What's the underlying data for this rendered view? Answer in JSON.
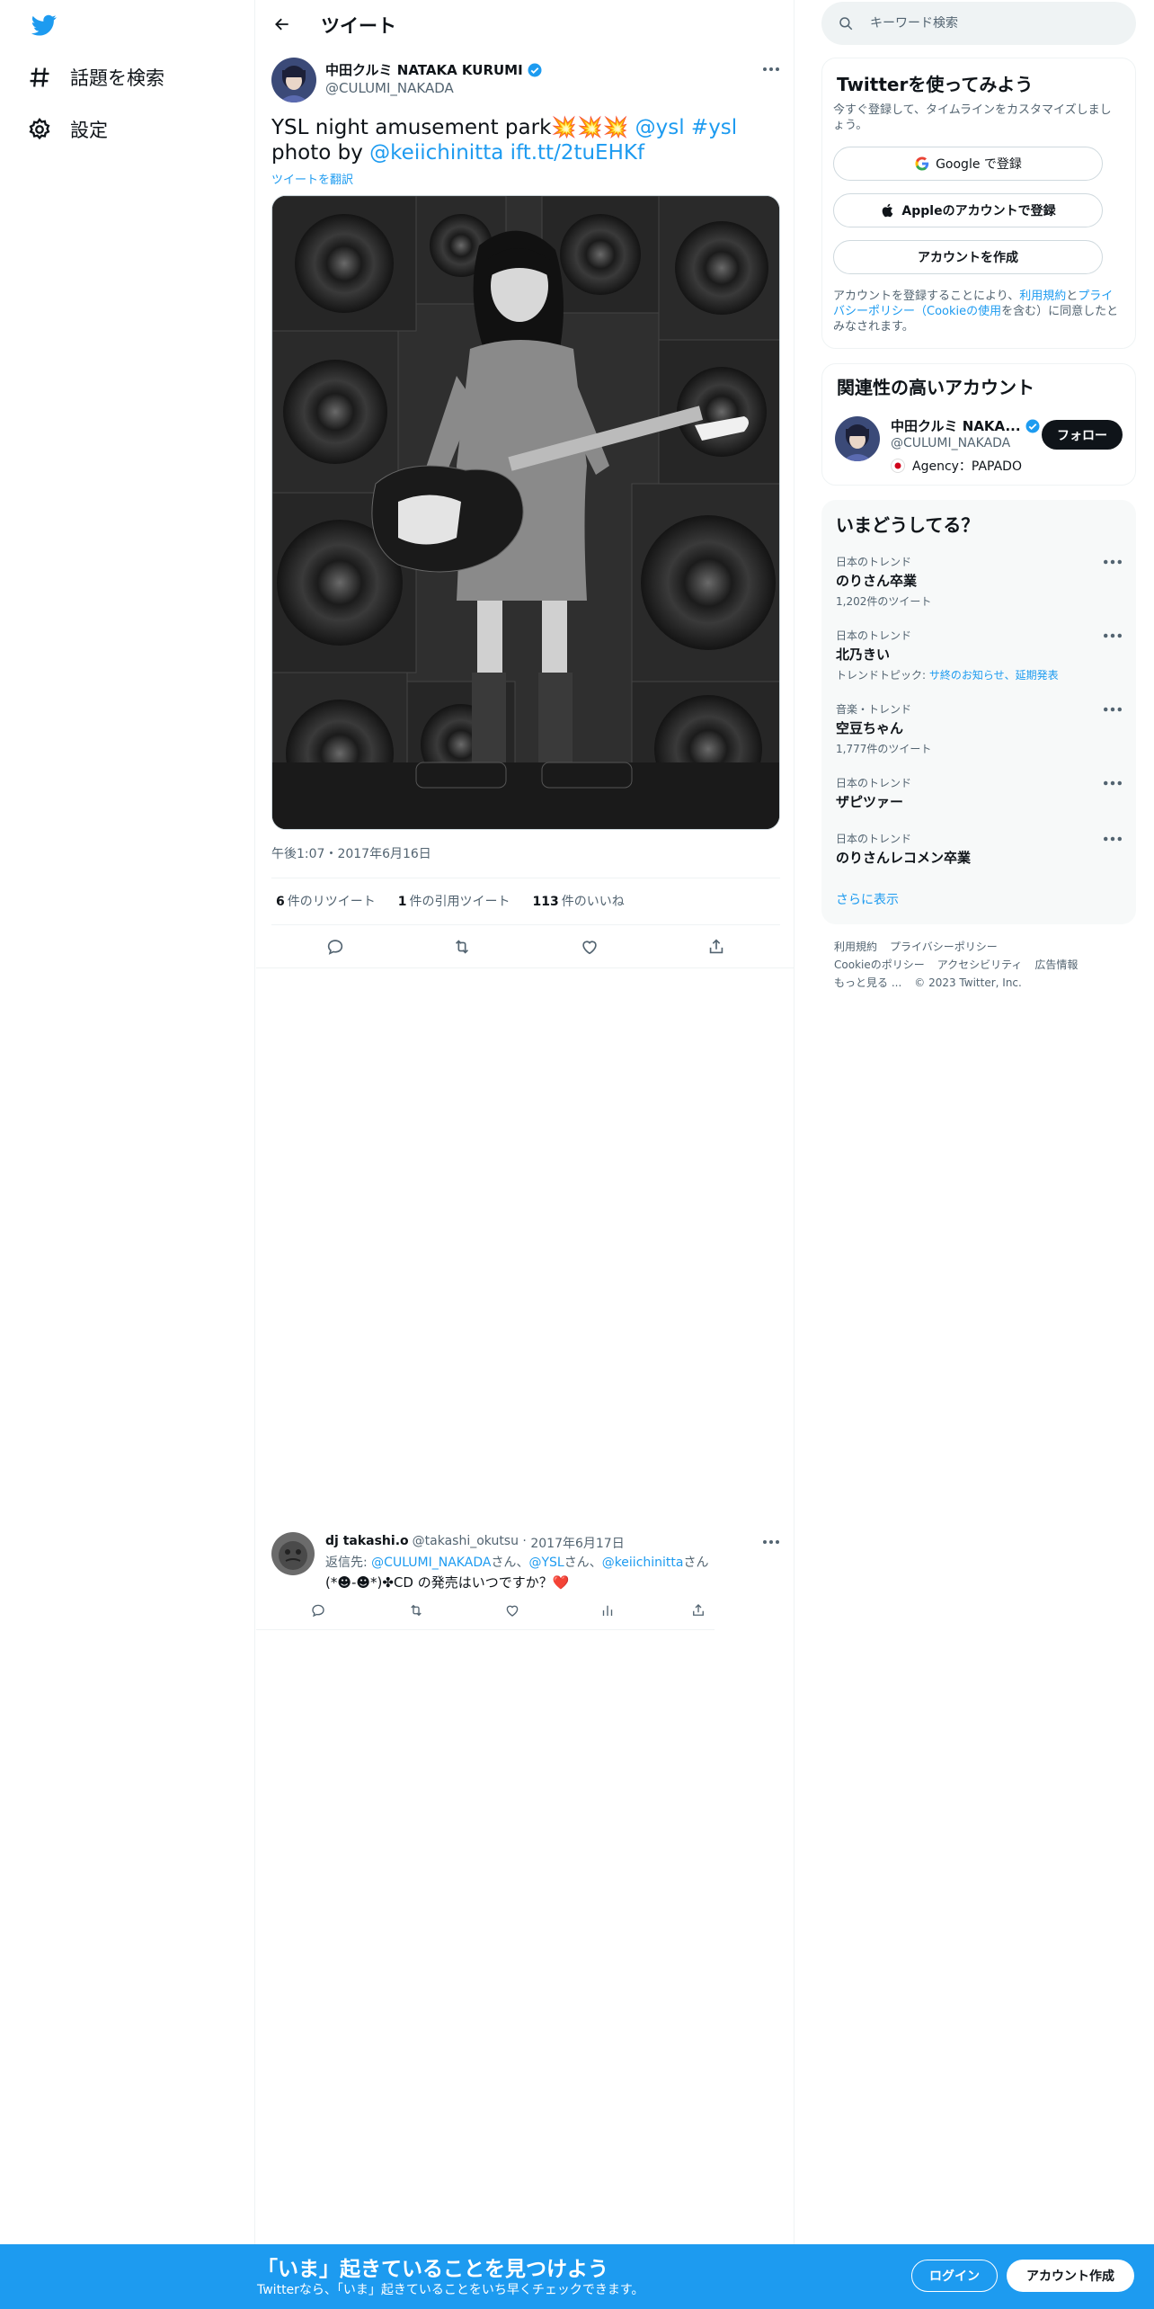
{
  "nav": {
    "logo_icon": "twitter-bird-icon",
    "explore_label": "話題を検索",
    "settings_label": "設定"
  },
  "header": {
    "title": "ツイート"
  },
  "tweet": {
    "author_name": "中田クルミ NATAKA KURUMI",
    "author_handle": "@CULUMI_NAKADA",
    "text_part1": "YSL night amusement park💥💥💥 ",
    "mention_ysl": "@ysl",
    "hashtag_ysl": "#ysl",
    "text_photo_by": "photo by ",
    "mention_photographer": "@keiichinitta",
    "link": "ift.tt/2tuEHKf",
    "translate_label": "ツイートを翻訳",
    "timestamp": "午後1:07・2017年6月16日",
    "retweets_count": "6",
    "retweets_label": "件のリツイート",
    "quotes_count": "1",
    "quotes_label": "件の引用ツイート",
    "likes_count": "113",
    "likes_label": "件のいいね"
  },
  "reply": {
    "author_name": "dj takashi.o",
    "author_handle": "@takashi_okutsu",
    "date": "2017年6月17日",
    "reply_to_label": "返信先:",
    "reply_to_1": "@CULUMI_NAKADA",
    "reply_to_2": "@YSL",
    "reply_to_3": "@keiichinitta",
    "san": "さん",
    "sep": "、",
    "text": "(*☻-☻*)✤CD の発売はいつですか？❤️"
  },
  "right": {
    "search_placeholder": "キーワード検索",
    "signup_title": "Twitterを使ってみよう",
    "signup_desc": "今すぐ登録して、タイムラインをカスタマイズしましょう。",
    "google_btn": "Google で登録",
    "apple_btn": "Appleのアカウントで登録",
    "create_btn": "アカウントを作成",
    "terms_prefix": "アカウントを登録することにより、",
    "terms_link": "利用規約",
    "terms_and": "と",
    "privacy_link": "プライバシーポリシー（Cookieの使用",
    "terms_suffix": "を含む）に同意したとみなされます。",
    "related_title": "関連性の高いアカウント",
    "related_name": "中田クルミ NAKA...",
    "related_handle": "@CULUMI_NAKADA",
    "related_bio": "Agency：PAPADO",
    "follow_label": "フォロー",
    "trends_title": "いまどうしてる？",
    "trends": [
      {
        "category": "日本のトレンド",
        "name": "のりさん卒業",
        "meta": "1,202件のツイート"
      },
      {
        "category": "日本のトレンド",
        "name": "北乃きい",
        "meta_prefix": "トレンドトピック: ",
        "meta_link": "サ終のお知らせ、延期発表"
      },
      {
        "category": "音楽・トレンド",
        "name": "空豆ちゃん",
        "meta": "1,777件のツイート"
      },
      {
        "category": "日本のトレンド",
        "name": "ザピツァー"
      },
      {
        "category": "日本のトレンド",
        "name": "のりさんレコメン卒業"
      }
    ],
    "show_more": "さらに表示",
    "footer": {
      "terms": "利用規約",
      "privacy": "プライバシーポリシー",
      "cookie": "Cookieのポリシー",
      "accessibility": "アクセシビリティ",
      "ads": "広告情報",
      "more": "もっと見る ...",
      "copyright": "© 2023 Twitter, Inc."
    }
  },
  "bottom": {
    "title": "「いま」起きていることを見つけよう",
    "subtitle": "Twitterなら、「いま」起きていることをいち早くチェックできます。",
    "login": "ログイン",
    "signup": "アカウント作成"
  },
  "colors": {
    "brand": "#1d9bf0",
    "text": "#0f1419",
    "secondary": "#536471"
  }
}
